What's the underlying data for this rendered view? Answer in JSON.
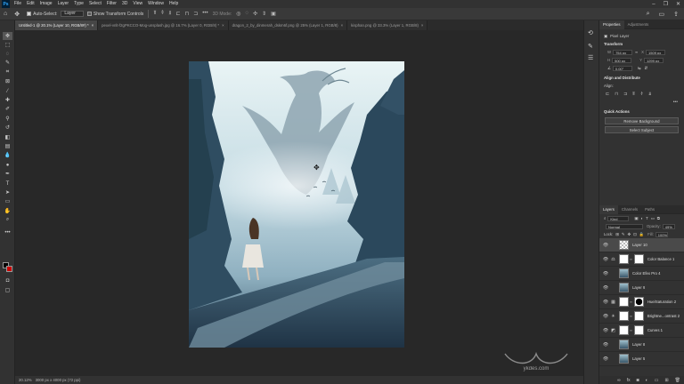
{
  "menu": {
    "items": [
      "File",
      "Edit",
      "Image",
      "Layer",
      "Type",
      "Select",
      "Filter",
      "3D",
      "View",
      "Window",
      "Help"
    ]
  },
  "options": {
    "auto_select_label": "Auto-Select:",
    "auto_select_value": "Layer",
    "show_transform_label": "Show Transform Controls",
    "three_d_mode": "3D Mode:"
  },
  "tabs": [
    {
      "label": "Untitled-1 @ 20.1% (Layer 10, RGB/8#) *",
      "active": true
    },
    {
      "label": "pexel-vnlt-f2gPKCCO-Mog-unsplash.jpg @ 16.7% (Layer 0, RGB/8) *",
      "active": false
    },
    {
      "label": "dragon_2_by_dinmerah_dskm6f.png @ 25% (Layer 1, RGB/8)",
      "active": false
    },
    {
      "label": "kisphan.png @ 33.3% (Layer 1, RGB/8)",
      "active": false
    }
  ],
  "status": {
    "zoom": "20.12%",
    "doc_size": "3000 px x 4000 px (72 ppi)"
  },
  "watermark_text": "ykdes.com",
  "properties": {
    "tab_properties": "Properties",
    "tab_adjustments": "Adjustments",
    "pixel_layer": "Pixel Layer",
    "transform_title": "Transform",
    "w_label": "W",
    "w_value": "754 px",
    "x_label": "X",
    "x_value": "1509 px",
    "h_label": "H",
    "h_value": "500 px",
    "y_label": "Y",
    "y_value": "1299 px",
    "angle_value": "0.00°",
    "align_title": "Align and Distribute",
    "align_label": "Align:",
    "quick_title": "Quick Actions",
    "remove_bg": "Remove Background",
    "select_subject": "Select Subject"
  },
  "layers_panel": {
    "tab_layers": "Layers",
    "tab_channels": "Channels",
    "tab_paths": "Paths",
    "kind_label": "Kind",
    "blend_mode": "Normal",
    "opacity_label": "Opacity:",
    "opacity_value": "49%",
    "lock_label": "Lock:",
    "fill_label": "Fill:",
    "fill_value": "100%",
    "layers": [
      {
        "name": "Layer 10",
        "thumb": "check",
        "adj": "",
        "mask": false,
        "selected": true
      },
      {
        "name": "Color Balance 1",
        "thumb": "white",
        "adj": "⚖",
        "mask": true,
        "selected": false
      },
      {
        "name": "Color Efex Pro 4",
        "thumb": "img",
        "adj": "",
        "mask": false,
        "selected": false
      },
      {
        "name": "Layer 9",
        "thumb": "img",
        "adj": "",
        "mask": false,
        "selected": false
      },
      {
        "name": "Hue/Saturation 2",
        "thumb": "black",
        "adj": "▦",
        "mask": true,
        "selected": false
      },
      {
        "name": "Brightne...ontrast 2",
        "thumb": "white",
        "adj": "☀",
        "mask": true,
        "selected": false
      },
      {
        "name": "Curves 1",
        "thumb": "white",
        "adj": "◩",
        "mask": true,
        "selected": false
      },
      {
        "name": "Layer 8",
        "thumb": "img",
        "adj": "",
        "mask": false,
        "selected": false
      },
      {
        "name": "Layer 5",
        "thumb": "img",
        "adj": "",
        "mask": false,
        "selected": false
      }
    ]
  }
}
